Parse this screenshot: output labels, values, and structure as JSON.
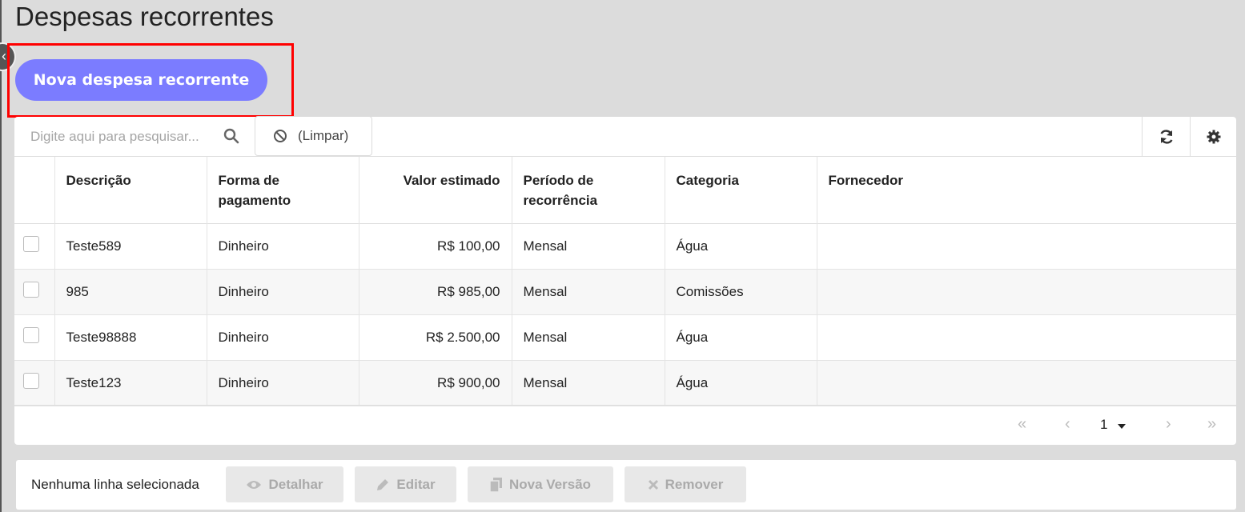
{
  "page": {
    "title": "Despesas recorrentes",
    "new_button_label": "Nova despesa recorrente"
  },
  "toolbar": {
    "search_placeholder": "Digite aqui para pesquisar...",
    "clear_label": "(Limpar)",
    "icons": [
      "search-icon",
      "ban-icon",
      "refresh-icon",
      "gear-icon"
    ]
  },
  "table": {
    "columns": [
      {
        "label": "Descrição"
      },
      {
        "label": "Forma de pagamento"
      },
      {
        "label": "Valor estimado"
      },
      {
        "label": "Período de recorrência"
      },
      {
        "label": "Categoria"
      },
      {
        "label": "Fornecedor"
      }
    ],
    "rows": [
      {
        "descricao": "Teste589",
        "forma": "Dinheiro",
        "valor": "R$ 100,00",
        "periodo": "Mensal",
        "categoria": "Água",
        "fornecedor": ""
      },
      {
        "descricao": "985",
        "forma": "Dinheiro",
        "valor": "R$ 985,00",
        "periodo": "Mensal",
        "categoria": "Comissões",
        "fornecedor": ""
      },
      {
        "descricao": "Teste98888",
        "forma": "Dinheiro",
        "valor": "R$ 2.500,00",
        "periodo": "Mensal",
        "categoria": "Água",
        "fornecedor": ""
      },
      {
        "descricao": "Teste123",
        "forma": "Dinheiro",
        "valor": "R$ 900,00",
        "periodo": "Mensal",
        "categoria": "Água",
        "fornecedor": ""
      }
    ]
  },
  "pagination": {
    "current_page": "1"
  },
  "actions": {
    "selection_status": "Nenhuma linha selecionada",
    "detalhar": "Detalhar",
    "editar": "Editar",
    "nova_versao": "Nova Versão",
    "remover": "Remover"
  },
  "colors": {
    "accent": "#7b7cff",
    "highlight": "#ff0000",
    "background": "#dcdcdc"
  }
}
